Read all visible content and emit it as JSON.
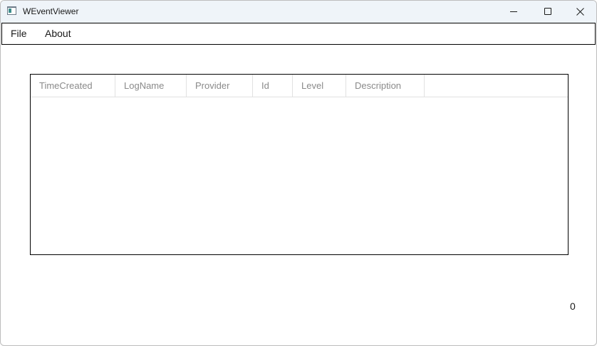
{
  "window": {
    "title": "WEventViewer",
    "icon": "app-window-icon"
  },
  "titlebar_buttons": {
    "minimize": "minimize-icon",
    "maximize": "maximize-icon",
    "close": "close-icon"
  },
  "menu": {
    "items": [
      {
        "label": "File"
      },
      {
        "label": "About"
      }
    ]
  },
  "table": {
    "columns": [
      "TimeCreated",
      "LogName",
      "Provider",
      "Id",
      "Level",
      "Description"
    ],
    "rows": []
  },
  "status": {
    "count": "0"
  }
}
